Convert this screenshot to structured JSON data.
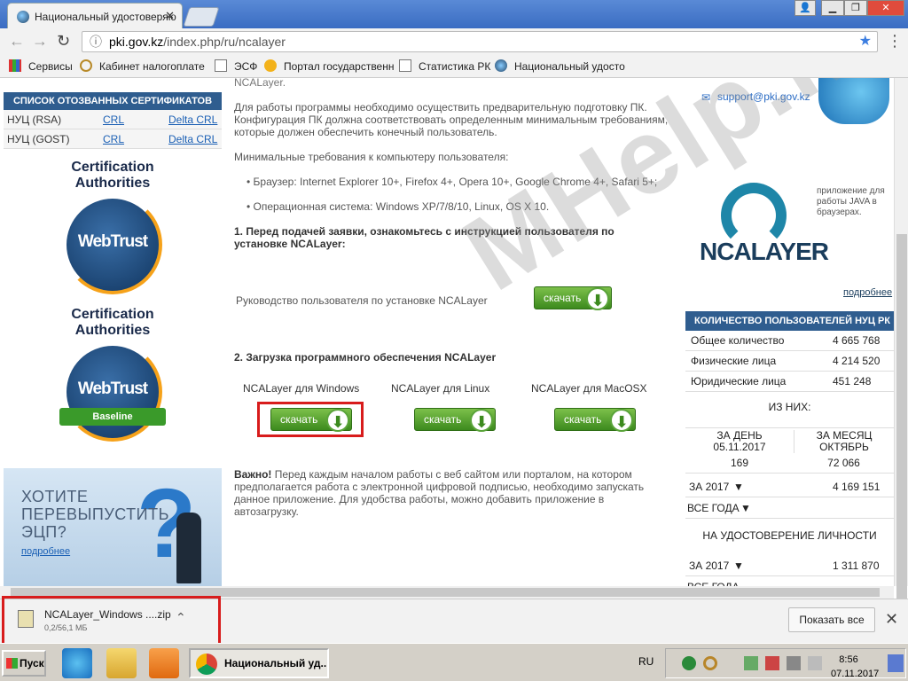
{
  "browser": {
    "tab_title": "Национальный удостоверяю",
    "url_host": "pki.gov.kz",
    "url_path": "/index.php/ru/ncalayer",
    "bookmarks": [
      "Сервисы",
      "Кабинет налогоплате",
      "ЭСФ",
      "Портал государственн",
      "Статистика РК",
      "Национальный удосто"
    ]
  },
  "left": {
    "revoked_header": "СПИСОК ОТОЗВАННЫХ СЕРТИФИКАТОВ",
    "rows": [
      {
        "name": "НУЦ (RSA)",
        "crl": "CRL",
        "delta": "Delta CRL"
      },
      {
        "name": "НУЦ (GOST)",
        "crl": "CRL",
        "delta": "Delta CRL"
      }
    ],
    "cert1_title": "Certification Authorities",
    "cert1_logo": "WebTrust",
    "cert2_title": "Certification Authorities",
    "cert2_logo": "WebTrust",
    "cert2_badge": "Baseline",
    "promo_text": "ХОТИТЕ\nПЕРЕВЫПУСТИТЬ\nЭЦП?",
    "promo_more": "подробнее"
  },
  "center": {
    "top_cut": "NCALayer.",
    "intro": "Для работы программы необходимо осуществить предварительную подготовку ПК. Конфигурация ПК должна соответствовать определенным минимальным требованиям, которые должен обеспечить конечный пользователь.",
    "req_title": "Минимальные требования к компьютеру пользователя:",
    "req_browser": "Браузер: Internet Explorer 10+, Firefox 4+, Opera 10+, Google Chrome 4+, Safari 5+;",
    "req_os": "Операционная система: Windows XP/7/8/10, Linux,  OS X 10.",
    "step1": "1.     Перед подачей заявки, ознакомьтесь с инструкцией пользователя по установке NCALayer:",
    "manual_label": "Руководство пользователя по установке NCALayer",
    "download_label": "скачать",
    "step2": "2. Загрузка программного обеспечения NCALayer",
    "col_windows": "NCALayer для Windows",
    "col_linux": "NCALayer для Linux",
    "col_mac": "NCALayer для  MacOSX",
    "important_bold": "Важно!",
    "important_text": " Перед каждым началом работы с веб сайтом или порталом, на котором предполагается работа с электронной цифровой подписью, необходимо запускать данное приложение. Для удобства работы, можно добавить приложение в автозагрузку."
  },
  "right": {
    "email": "support@pki.gov.kz",
    "ncalayer_logo": "NCALAYER",
    "ncalayer_caption": "приложение для работы JAVA в браузерах.",
    "more": "подробнее",
    "stats_header": "КОЛИЧЕСТВО ПОЛЬЗОВАТЕЛЕЙ НУЦ РК",
    "stats": [
      {
        "label": "Общее количество",
        "value": "4 665 768"
      },
      {
        "label": "Физические лица",
        "value": "4 214 520"
      },
      {
        "label": "Юридические лица",
        "value": "451 248"
      }
    ],
    "of_them": "ИЗ НИХ:",
    "day_label": "ЗА ДЕНЬ\n05.11.2017",
    "month_label": "ЗА МЕСЯЦ\nОКТЯБРЬ",
    "day_value": "169",
    "month_value": "72 066",
    "year_label": "ЗА 2017",
    "year_value": "4 169 151",
    "all_years": "ВСЕ ГОДА",
    "id_card": "НА УДОСТОВЕРЕНИЕ ЛИЧНОСТИ",
    "year2_label": "ЗА 2017",
    "year2_value": "1 311 870",
    "all_years2": "ВСЕ ГОДА"
  },
  "watermark": "MHelp.kz",
  "download_bar": {
    "file_name": "NCALayer_Windows ....zip",
    "file_size": "0,2/56,1 МБ",
    "show_all": "Показать все"
  },
  "taskbar": {
    "start": "Пуск",
    "active_window": "Национальный уд...",
    "lang": "RU",
    "time": "8:56",
    "date": "07.11.2017"
  }
}
